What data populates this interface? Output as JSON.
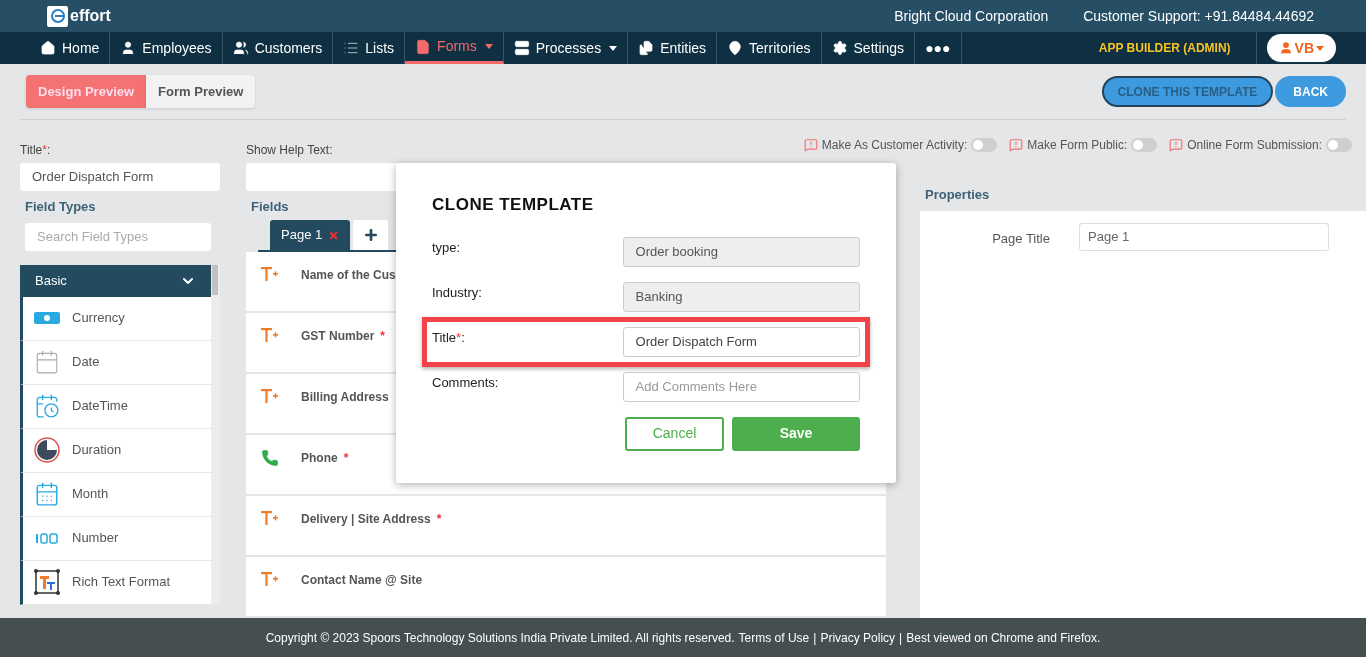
{
  "brand": {
    "name": "effort"
  },
  "header": {
    "company": "Bright Cloud Corporation",
    "support": "Customer Support: +91.84484.44692"
  },
  "nav": {
    "items": [
      {
        "label": "Home",
        "selected": false,
        "caret": false
      },
      {
        "label": "Employees",
        "selected": false,
        "caret": false
      },
      {
        "label": "Customers",
        "selected": false,
        "caret": false
      },
      {
        "label": "Lists",
        "selected": false,
        "caret": false
      },
      {
        "label": "Forms",
        "selected": true,
        "caret": true
      },
      {
        "label": "Processes",
        "selected": false,
        "caret": true
      },
      {
        "label": "Entities",
        "selected": false,
        "caret": false
      },
      {
        "label": "Territories",
        "selected": false,
        "caret": false
      },
      {
        "label": "Settings",
        "selected": false,
        "caret": false
      },
      {
        "label": "●●●",
        "selected": false,
        "caret": false
      }
    ],
    "role": "APP BUILDER (ADMIN)",
    "user": "VB"
  },
  "view_tabs": [
    {
      "label": "Design Preview",
      "selected": true
    },
    {
      "label": "Form Preview",
      "selected": false
    }
  ],
  "actions": [
    "CLONE THIS TEMPLATE",
    "BACK"
  ],
  "title_field": {
    "label": "Title",
    "asterisk": "*",
    "suffix": ":",
    "value": "Order Dispatch Form"
  },
  "help_text": {
    "label": "Show Help Text:"
  },
  "toggles": [
    {
      "label": "Make As Customer Activity:",
      "on": false
    },
    {
      "label": "Make Form Public:",
      "on": false
    },
    {
      "label": "Online Form Submission:",
      "on": false
    }
  ],
  "field_types": {
    "heading": "Field Types",
    "placeholder": "Search Field Types",
    "group": "Basic",
    "expanded": true,
    "items": [
      "Currency",
      "Date",
      "DateTime",
      "Duration",
      "Month",
      "Number",
      "Rich Text Format"
    ]
  },
  "fields": {
    "heading": "Fields",
    "page_tab": "Page 1",
    "rows": [
      {
        "label": "Name of the Cus",
        "kind": "text"
      },
      {
        "label": "GST Number",
        "kind": "text",
        "asterisk": "*"
      },
      {
        "label": "Billing Address",
        "kind": "text"
      },
      {
        "label": "Phone",
        "kind": "phone",
        "asterisk": "*"
      },
      {
        "label": "Delivery | Site Address",
        "kind": "text",
        "asterisk": "*"
      },
      {
        "label": "Contact Name @ Site",
        "kind": "text"
      }
    ]
  },
  "properties": {
    "heading": "Properties",
    "label": "Page Title",
    "value": "Page 1"
  },
  "dialog": {
    "title": "CLONE TEMPLATE",
    "rows": [
      {
        "label": "type:",
        "kind": "readonly",
        "value": "Order booking",
        "highlighted": false
      },
      {
        "label": "Industry:",
        "kind": "readonly",
        "value": "Banking",
        "highlighted": false
      },
      {
        "label": "Title",
        "asterisk": "*",
        "suffix": ":",
        "kind": "input",
        "value": "Order Dispatch Form",
        "highlighted": true
      },
      {
        "label": "Comments:",
        "kind": "input",
        "placeholder": "Add Comments Here",
        "highlighted": false
      }
    ],
    "cancel": "Cancel",
    "save": "Save"
  },
  "footer": {
    "text": "Copyright © 2023 Spoors Technology Solutions India Private Limited. All rights reserved.",
    "links": [
      "Terms of Use",
      "Privacy Policy",
      "Best viewed on Chrome and Firefox."
    ],
    "separator": [
      "|",
      "|"
    ]
  }
}
